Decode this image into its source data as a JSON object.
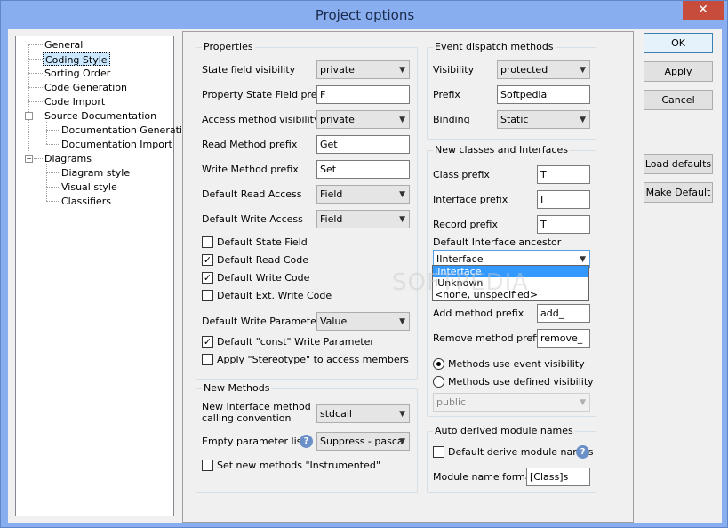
{
  "window": {
    "title": "Project options",
    "close_glyph": "✕"
  },
  "tree": {
    "items": [
      {
        "label": "General"
      },
      {
        "label": "Coding Style",
        "selected": true
      },
      {
        "label": "Sorting Order"
      },
      {
        "label": "Code Generation"
      },
      {
        "label": "Code Import"
      },
      {
        "label": "Source Documentation"
      },
      {
        "label": "Documentation Generation"
      },
      {
        "label": "Documentation Import"
      },
      {
        "label": "Diagrams"
      },
      {
        "label": "Diagram style"
      },
      {
        "label": "Visual style"
      },
      {
        "label": "Classifiers"
      }
    ],
    "toggle_glyph": "−"
  },
  "properties": {
    "title": "Properties",
    "state_field_visibility": {
      "label": "State field visibility",
      "value": "private"
    },
    "property_state_field_prefix": {
      "label": "Property State Field prefix",
      "value": "F"
    },
    "access_method_visibility": {
      "label": "Access method visibility",
      "value": "private"
    },
    "read_method_prefix": {
      "label": "Read Method prefix",
      "value": "Get"
    },
    "write_method_prefix": {
      "label": "Write Method prefix",
      "value": "Set"
    },
    "default_read_access": {
      "label": "Default Read Access",
      "value": "Field"
    },
    "default_write_access": {
      "label": "Default Write Access",
      "value": "Field"
    },
    "default_state_field": {
      "label": "Default State Field",
      "checked": false
    },
    "default_read_code": {
      "label": "Default Read Code",
      "checked": true
    },
    "default_write_code": {
      "label": "Default Write Code",
      "checked": true
    },
    "default_ext_write_code": {
      "label": "Default Ext. Write Code",
      "checked": false
    },
    "default_write_parameter": {
      "label": "Default Write Parameter",
      "value": "Value"
    },
    "default_const_write_parameter": {
      "label": "Default \"const\" Write Parameter",
      "checked": true
    },
    "apply_stereotype": {
      "label": "Apply \"Stereotype\" to access members",
      "checked": false
    }
  },
  "new_methods": {
    "title": "New Methods",
    "calling_convention": {
      "label_line1": "New Interface method",
      "label_line2": "calling convention",
      "value": "stdcall"
    },
    "empty_parameter_lists": {
      "label": "Empty parameter lists",
      "value": "Suppress - pasca"
    },
    "set_instrumented": {
      "label": "Set new methods \"Instrumented\"",
      "checked": false
    }
  },
  "event_dispatch": {
    "title": "Event dispatch methods",
    "visibility": {
      "label": "Visibility",
      "value": "protected"
    },
    "prefix": {
      "label": "Prefix",
      "value": "Softpedia"
    },
    "binding": {
      "label": "Binding",
      "value": "Static"
    }
  },
  "new_classes": {
    "title": "New classes and Interfaces",
    "class_prefix": {
      "label": "Class prefix",
      "value": "T"
    },
    "interface_prefix": {
      "label": "Interface prefix",
      "value": "I"
    },
    "record_prefix": {
      "label": "Record prefix",
      "value": "T"
    },
    "default_interface_ancestor": {
      "label": "Default Interface ancestor",
      "value": "IInterface",
      "options": [
        "IInterface",
        "IUnknown",
        "<none, unspecified>"
      ]
    },
    "add_method_prefix": {
      "label": "Add method prefix",
      "value": "add_"
    },
    "remove_method_prefix": {
      "label": "Remove method prefix",
      "value": "remove_"
    },
    "methods_use_event_visibility": {
      "label": "Methods use event visibility",
      "selected": true
    },
    "methods_use_defined_visibility": {
      "label": "Methods use defined visibility",
      "selected": false
    },
    "defined_visibility": {
      "value": "public"
    }
  },
  "auto_derived": {
    "title": "Auto derived module names",
    "default_derive": {
      "label": "Default derive module names",
      "checked": false
    },
    "module_name_format": {
      "label": "Module name format",
      "value": "[Class]s"
    }
  },
  "buttons": {
    "ok": "OK",
    "apply": "Apply",
    "cancel": "Cancel",
    "load_defaults": "Load defaults",
    "make_default": "Make Default"
  },
  "watermark": "SOFTPEDIA",
  "colors": {
    "title_bar": "#89aef0",
    "close": "#c74c3c",
    "selection": "#3399ff"
  }
}
